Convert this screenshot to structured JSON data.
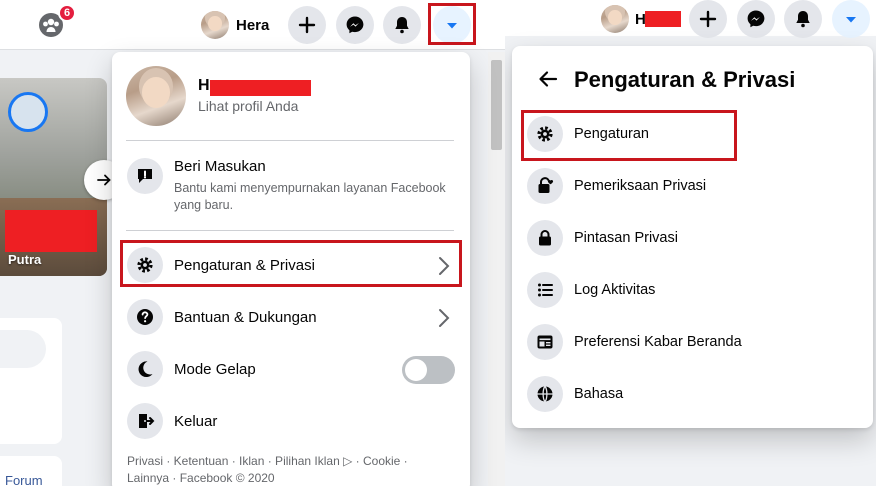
{
  "left": {
    "groups_badge": "6",
    "profile_name": "Hera",
    "story_name": "Putra",
    "forum_text": "Forum",
    "menu": {
      "profile_name_initial": "H",
      "profile_sub": "Lihat profil Anda",
      "feedback_title": "Beri Masukan",
      "feedback_desc": "Bantu kami menyempurnakan layanan Facebook yang baru.",
      "items": [
        {
          "label": "Pengaturan & Privasi",
          "icon": "gear-icon"
        },
        {
          "label": "Bantuan & Dukungan",
          "icon": "question-icon"
        },
        {
          "label": "Mode Gelap",
          "icon": "moon-icon"
        },
        {
          "label": "Keluar",
          "icon": "logout-icon"
        }
      ],
      "dark_mode_on": false,
      "footer_line1": "Privasi · Ketentuan · Iklan · Pilihan Iklan ▷ · Cookie ·",
      "footer_line2": "Lainnya · Facebook © 2020"
    }
  },
  "right": {
    "profile_name_initial": "H",
    "title": "Pengaturan & Privasi",
    "items": [
      {
        "label": "Pengaturan",
        "icon": "gear-icon"
      },
      {
        "label": "Pemeriksaan Privasi",
        "icon": "lock-heart-icon"
      },
      {
        "label": "Pintasan Privasi",
        "icon": "lock-icon"
      },
      {
        "label": "Log Aktivitas",
        "icon": "list-icon"
      },
      {
        "label": "Preferensi Kabar Beranda",
        "icon": "news-feed-icon"
      },
      {
        "label": "Bahasa",
        "icon": "globe-icon"
      }
    ]
  },
  "colors": {
    "highlight_red": "#c8161d",
    "redaction": "#ee1f23",
    "accent_blue": "#1877f2"
  }
}
